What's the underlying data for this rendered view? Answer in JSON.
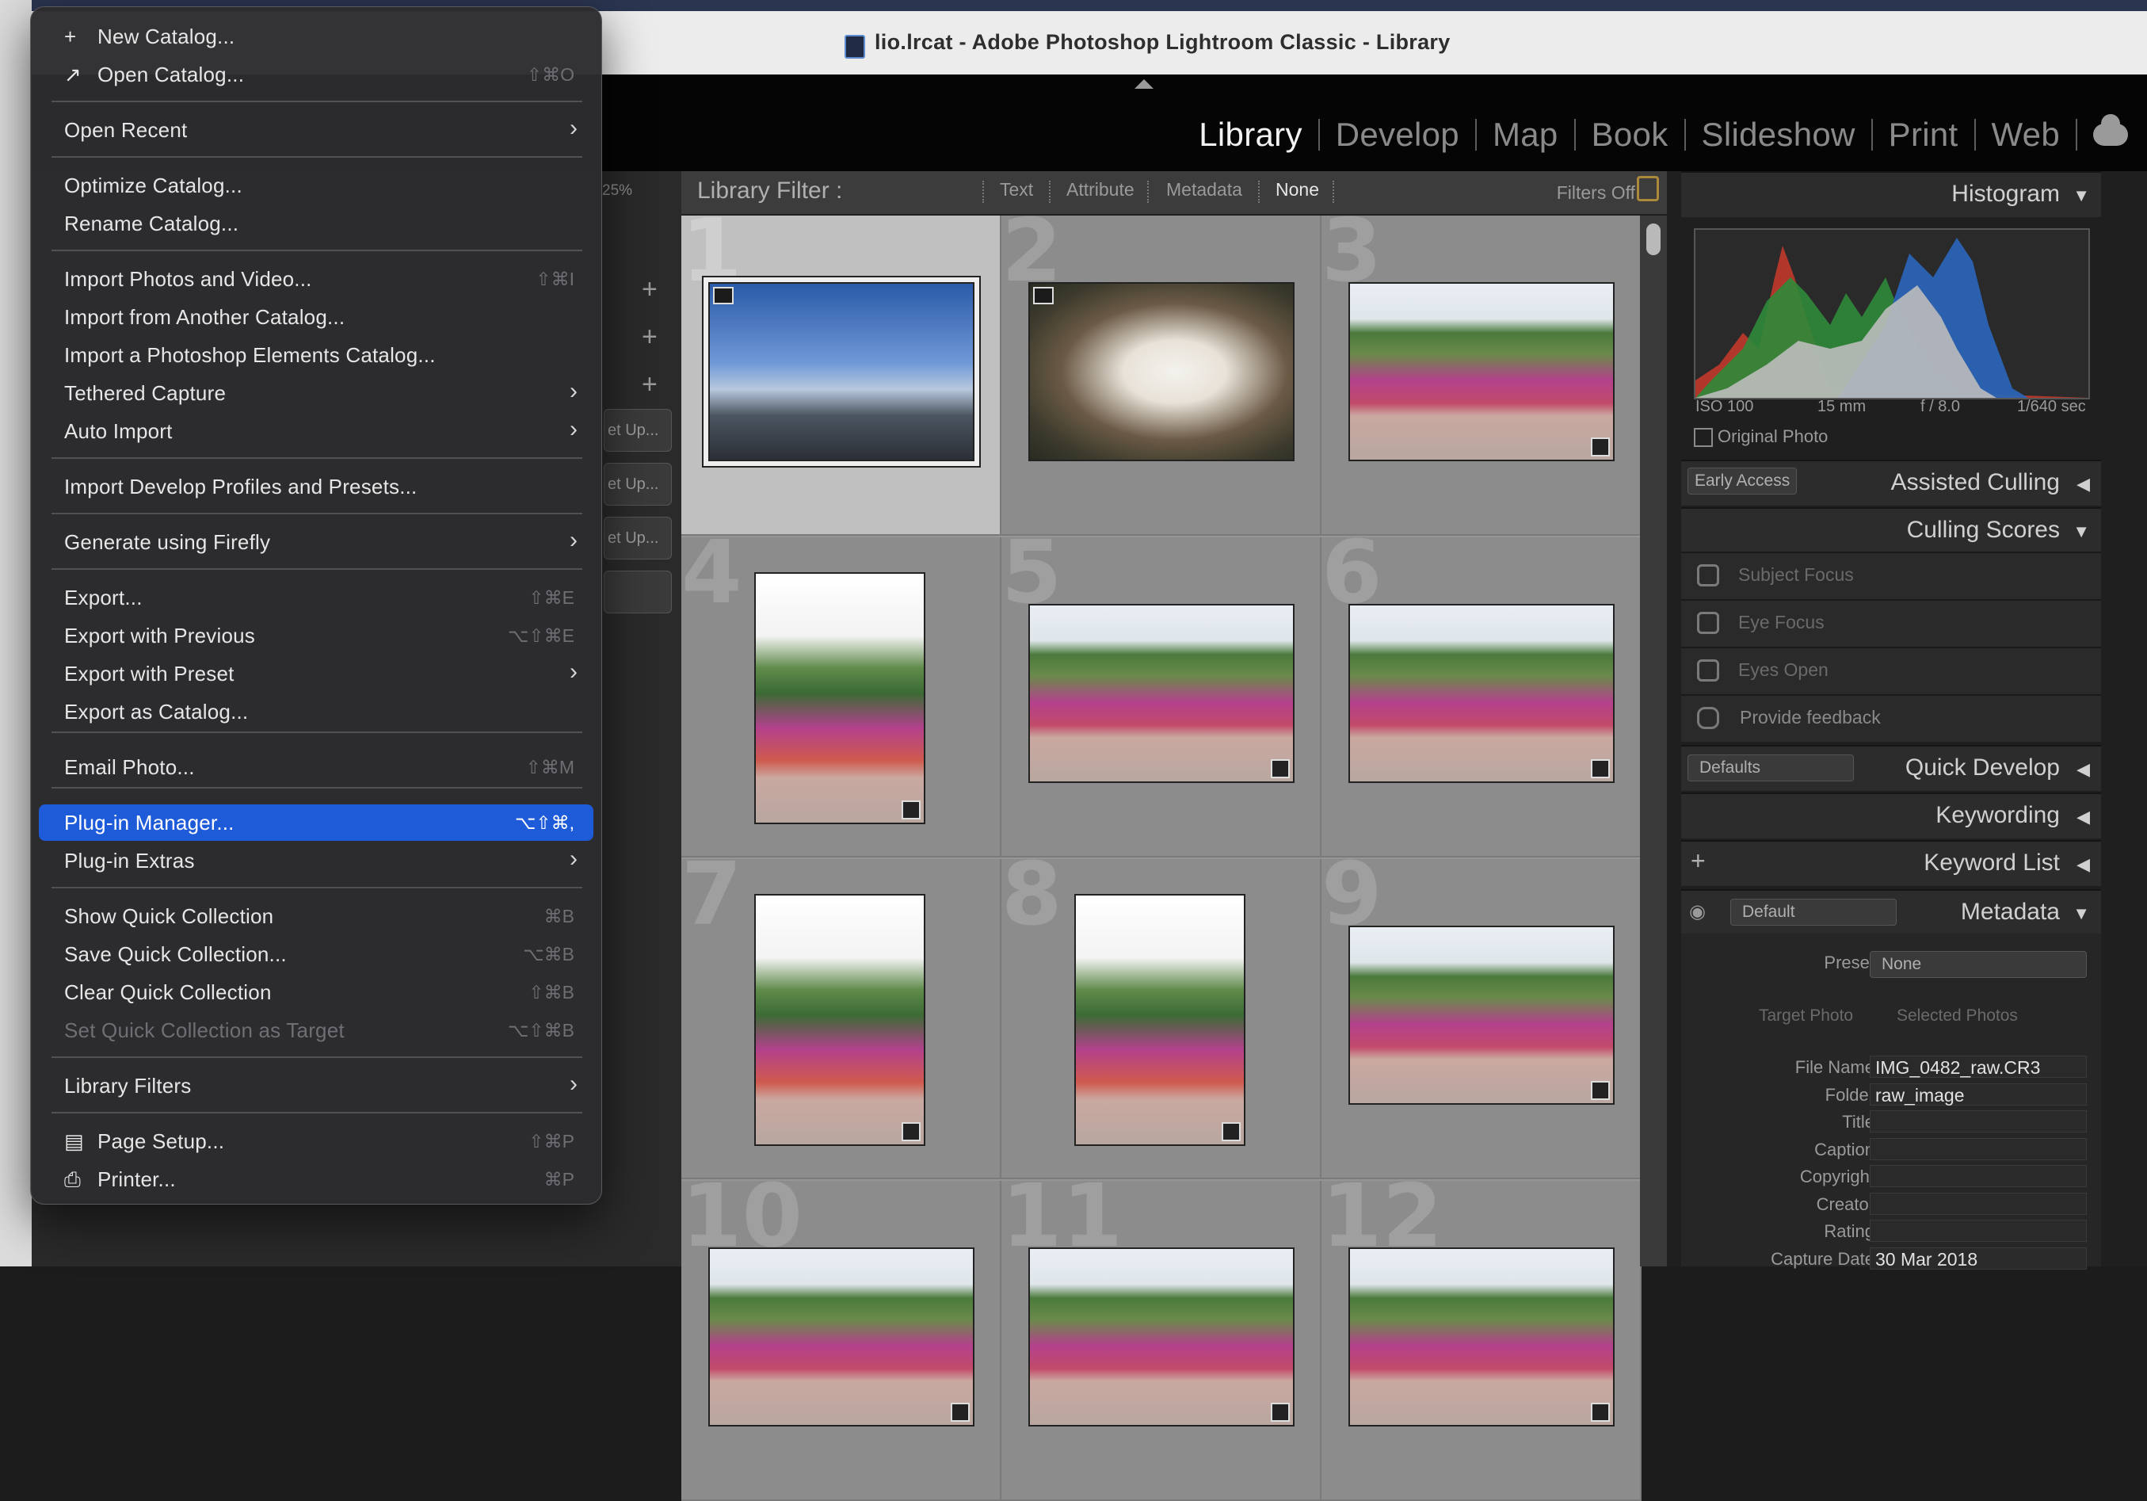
{
  "window": {
    "title": "lio.lrcat - Adobe Photoshop Lightroom Classic - Library"
  },
  "modules": [
    {
      "label": "Library",
      "active": true
    },
    {
      "label": "Develop",
      "active": false
    },
    {
      "label": "Map",
      "active": false
    },
    {
      "label": "Book",
      "active": false
    },
    {
      "label": "Slideshow",
      "active": false
    },
    {
      "label": "Print",
      "active": false
    },
    {
      "label": "Web",
      "active": false
    }
  ],
  "left_panel": {
    "zoom_label": "25%",
    "setup_buttons": [
      "et Up...",
      "et Up...",
      "et Up..."
    ]
  },
  "library_filter": {
    "title": "Library Filter :",
    "options": [
      "Text",
      "Attribute",
      "Metadata",
      "None"
    ],
    "selected": "None",
    "filters_off": "Filters Off"
  },
  "grid": {
    "cells": [
      {
        "num": "1",
        "kind": "sky",
        "selected": true
      },
      {
        "num": "2",
        "kind": "flower",
        "selected": false
      },
      {
        "num": "3",
        "kind": "group",
        "selected": false
      },
      {
        "num": "4",
        "kind": "groupv",
        "selected": false
      },
      {
        "num": "5",
        "kind": "group",
        "selected": false
      },
      {
        "num": "6",
        "kind": "group",
        "selected": false
      },
      {
        "num": "7",
        "kind": "groupv",
        "selected": false
      },
      {
        "num": "8",
        "kind": "groupv",
        "selected": false
      },
      {
        "num": "9",
        "kind": "group",
        "selected": false
      },
      {
        "num": "10",
        "kind": "group",
        "selected": false
      },
      {
        "num": "11",
        "kind": "group",
        "selected": false
      },
      {
        "num": "12",
        "kind": "group",
        "selected": false
      }
    ]
  },
  "right_panel": {
    "histogram": {
      "label": "Histogram",
      "iso": "ISO 100",
      "focal": "15 mm",
      "aperture": "f / 8.0",
      "shutter": "1/640 sec",
      "original_photo": "Original Photo"
    },
    "early_access": "Early Access",
    "assisted_culling": "Assisted Culling",
    "culling_scores": "Culling Scores",
    "culling_items": [
      "Subject Focus",
      "Eye Focus",
      "Eyes Open",
      "Provide feedback"
    ],
    "quick_develop": {
      "preset": "Defaults",
      "label": "Quick Develop"
    },
    "keywording": "Keywording",
    "keyword_list": "Keyword List",
    "metadata": {
      "label": "Metadata",
      "preset_dropdown": "Default",
      "preset_label": "Preset",
      "preset_value": "None",
      "target_photo": "Target Photo",
      "selected_photos": "Selected Photos",
      "fields": [
        {
          "label": "File Name",
          "value": "IMG_0482_raw.CR3"
        },
        {
          "label": "Folder",
          "value": "raw_image"
        },
        {
          "label": "Title",
          "value": ""
        },
        {
          "label": "Caption",
          "value": ""
        },
        {
          "label": "Copyright",
          "value": ""
        },
        {
          "label": "Creator",
          "value": ""
        },
        {
          "label": "Rating",
          "value": ""
        },
        {
          "label": "Capture Date",
          "value": "30 Mar 2018"
        }
      ]
    }
  },
  "file_menu": {
    "items": [
      {
        "label": "New Catalog...",
        "shortcut": "",
        "lead": "+"
      },
      {
        "label": "Open Catalog...",
        "shortcut": "⇧⌘O",
        "lead": "↗"
      },
      {
        "label": "Open Recent",
        "submenu": true
      },
      {
        "label": "Optimize Catalog...",
        "shortcut": ""
      },
      {
        "label": "Rename Catalog...",
        "shortcut": ""
      },
      {
        "label": "Import Photos and Video...",
        "shortcut": "⇧⌘I"
      },
      {
        "label": "Import from Another Catalog...",
        "shortcut": ""
      },
      {
        "label": "Import a Photoshop Elements Catalog...",
        "shortcut": ""
      },
      {
        "label": "Tethered Capture",
        "submenu": true
      },
      {
        "label": "Auto Import",
        "submenu": true
      },
      {
        "label": "Import Develop Profiles and Presets...",
        "shortcut": ""
      },
      {
        "label": "Generate using Firefly",
        "submenu": true
      },
      {
        "label": "Export...",
        "shortcut": "⇧⌘E"
      },
      {
        "label": "Export with Previous",
        "shortcut": "⌥⇧⌘E"
      },
      {
        "label": "Export with Preset",
        "submenu": true
      },
      {
        "label": "Export as Catalog...",
        "shortcut": ""
      },
      {
        "label": "Email Photo...",
        "shortcut": "⇧⌘M"
      },
      {
        "label": "Plug-in Manager...",
        "shortcut": "⌥⇧⌘,",
        "highlighted": true
      },
      {
        "label": "Plug-in Extras",
        "submenu": true
      },
      {
        "label": "Show Quick Collection",
        "shortcut": "⌘B"
      },
      {
        "label": "Save Quick Collection...",
        "shortcut": "⌥⌘B"
      },
      {
        "label": "Clear Quick Collection",
        "shortcut": "⇧⌘B"
      },
      {
        "label": "Set Quick Collection as Target",
        "shortcut": "⌥⇧⌘B",
        "disabled": true
      },
      {
        "label": "Library Filters",
        "submenu": true
      },
      {
        "label": "Page Setup...",
        "shortcut": "⇧⌘P",
        "lead": "▤"
      },
      {
        "label": "Printer...",
        "shortcut": "⌘P",
        "lead": "⎙"
      }
    ]
  }
}
